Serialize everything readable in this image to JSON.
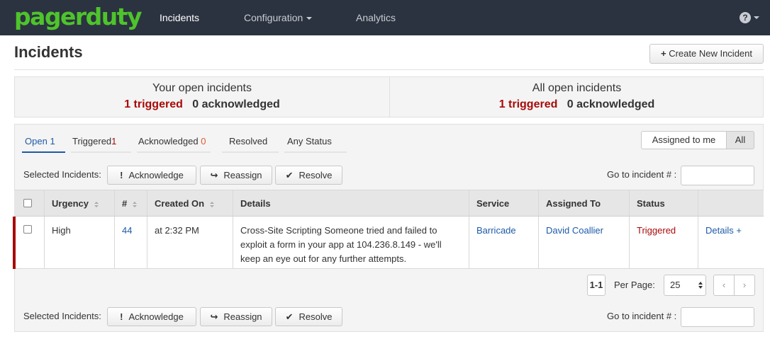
{
  "nav": {
    "logo": "pagerduty",
    "items": [
      {
        "label": "Incidents"
      },
      {
        "label": "Configuration"
      },
      {
        "label": "Analytics"
      }
    ],
    "help_glyph": "?"
  },
  "page": {
    "title": "Incidents",
    "create_button": "Create New Incident",
    "create_icon_glyph": "+"
  },
  "summary": {
    "your": {
      "title": "Your open incidents",
      "triggered": "1 triggered",
      "acknowledged": "0 acknowledged"
    },
    "all": {
      "title": "All open incidents",
      "triggered": "1 triggered",
      "acknowledged": "0 acknowledged"
    }
  },
  "tabs": [
    {
      "label": "Open",
      "count": "1"
    },
    {
      "label": "Triggered",
      "count": "1"
    },
    {
      "label": "Acknowledged",
      "count": "0"
    },
    {
      "label": "Resolved",
      "count": ""
    },
    {
      "label": "Any Status",
      "count": ""
    }
  ],
  "assignment_filter": {
    "assigned_to_me": "Assigned to me",
    "all": "All",
    "selected": "All"
  },
  "toolbar": {
    "selected_label": "Selected Incidents:",
    "acknowledge": "Acknowledge",
    "acknowledge_icon_glyph": "!",
    "reassign": "Reassign",
    "reassign_icon_glyph": "↪",
    "resolve": "Resolve",
    "resolve_icon_glyph": "✔",
    "goto_label": "Go to incident # :"
  },
  "table": {
    "headers": {
      "urgency": "Urgency",
      "number": "#",
      "created_on": "Created On",
      "details": "Details",
      "service": "Service",
      "assigned_to": "Assigned To",
      "status": "Status"
    },
    "rows": [
      {
        "urgency": "High",
        "number": "44",
        "created_on": "at 2:32 PM",
        "details": "Cross-Site Scripting Someone tried and failed to exploit a form in your app at 104.236.8.149 - we'll keep an eye out for any further attempts.",
        "service": "Barricade",
        "assigned_to": "David Coallier",
        "status": "Triggered",
        "details_link": "Details +"
      }
    ]
  },
  "pagination": {
    "range": "1-1",
    "per_page_label": "Per Page:",
    "per_page_value": "25",
    "prev_glyph": "‹",
    "next_glyph": "›"
  },
  "colors": {
    "navbar": "#2c3340",
    "logo": "#4ec42c",
    "triggered": "#a80a0a",
    "link": "#1d5aa8",
    "acknowledged_count": "#e05a2b"
  }
}
